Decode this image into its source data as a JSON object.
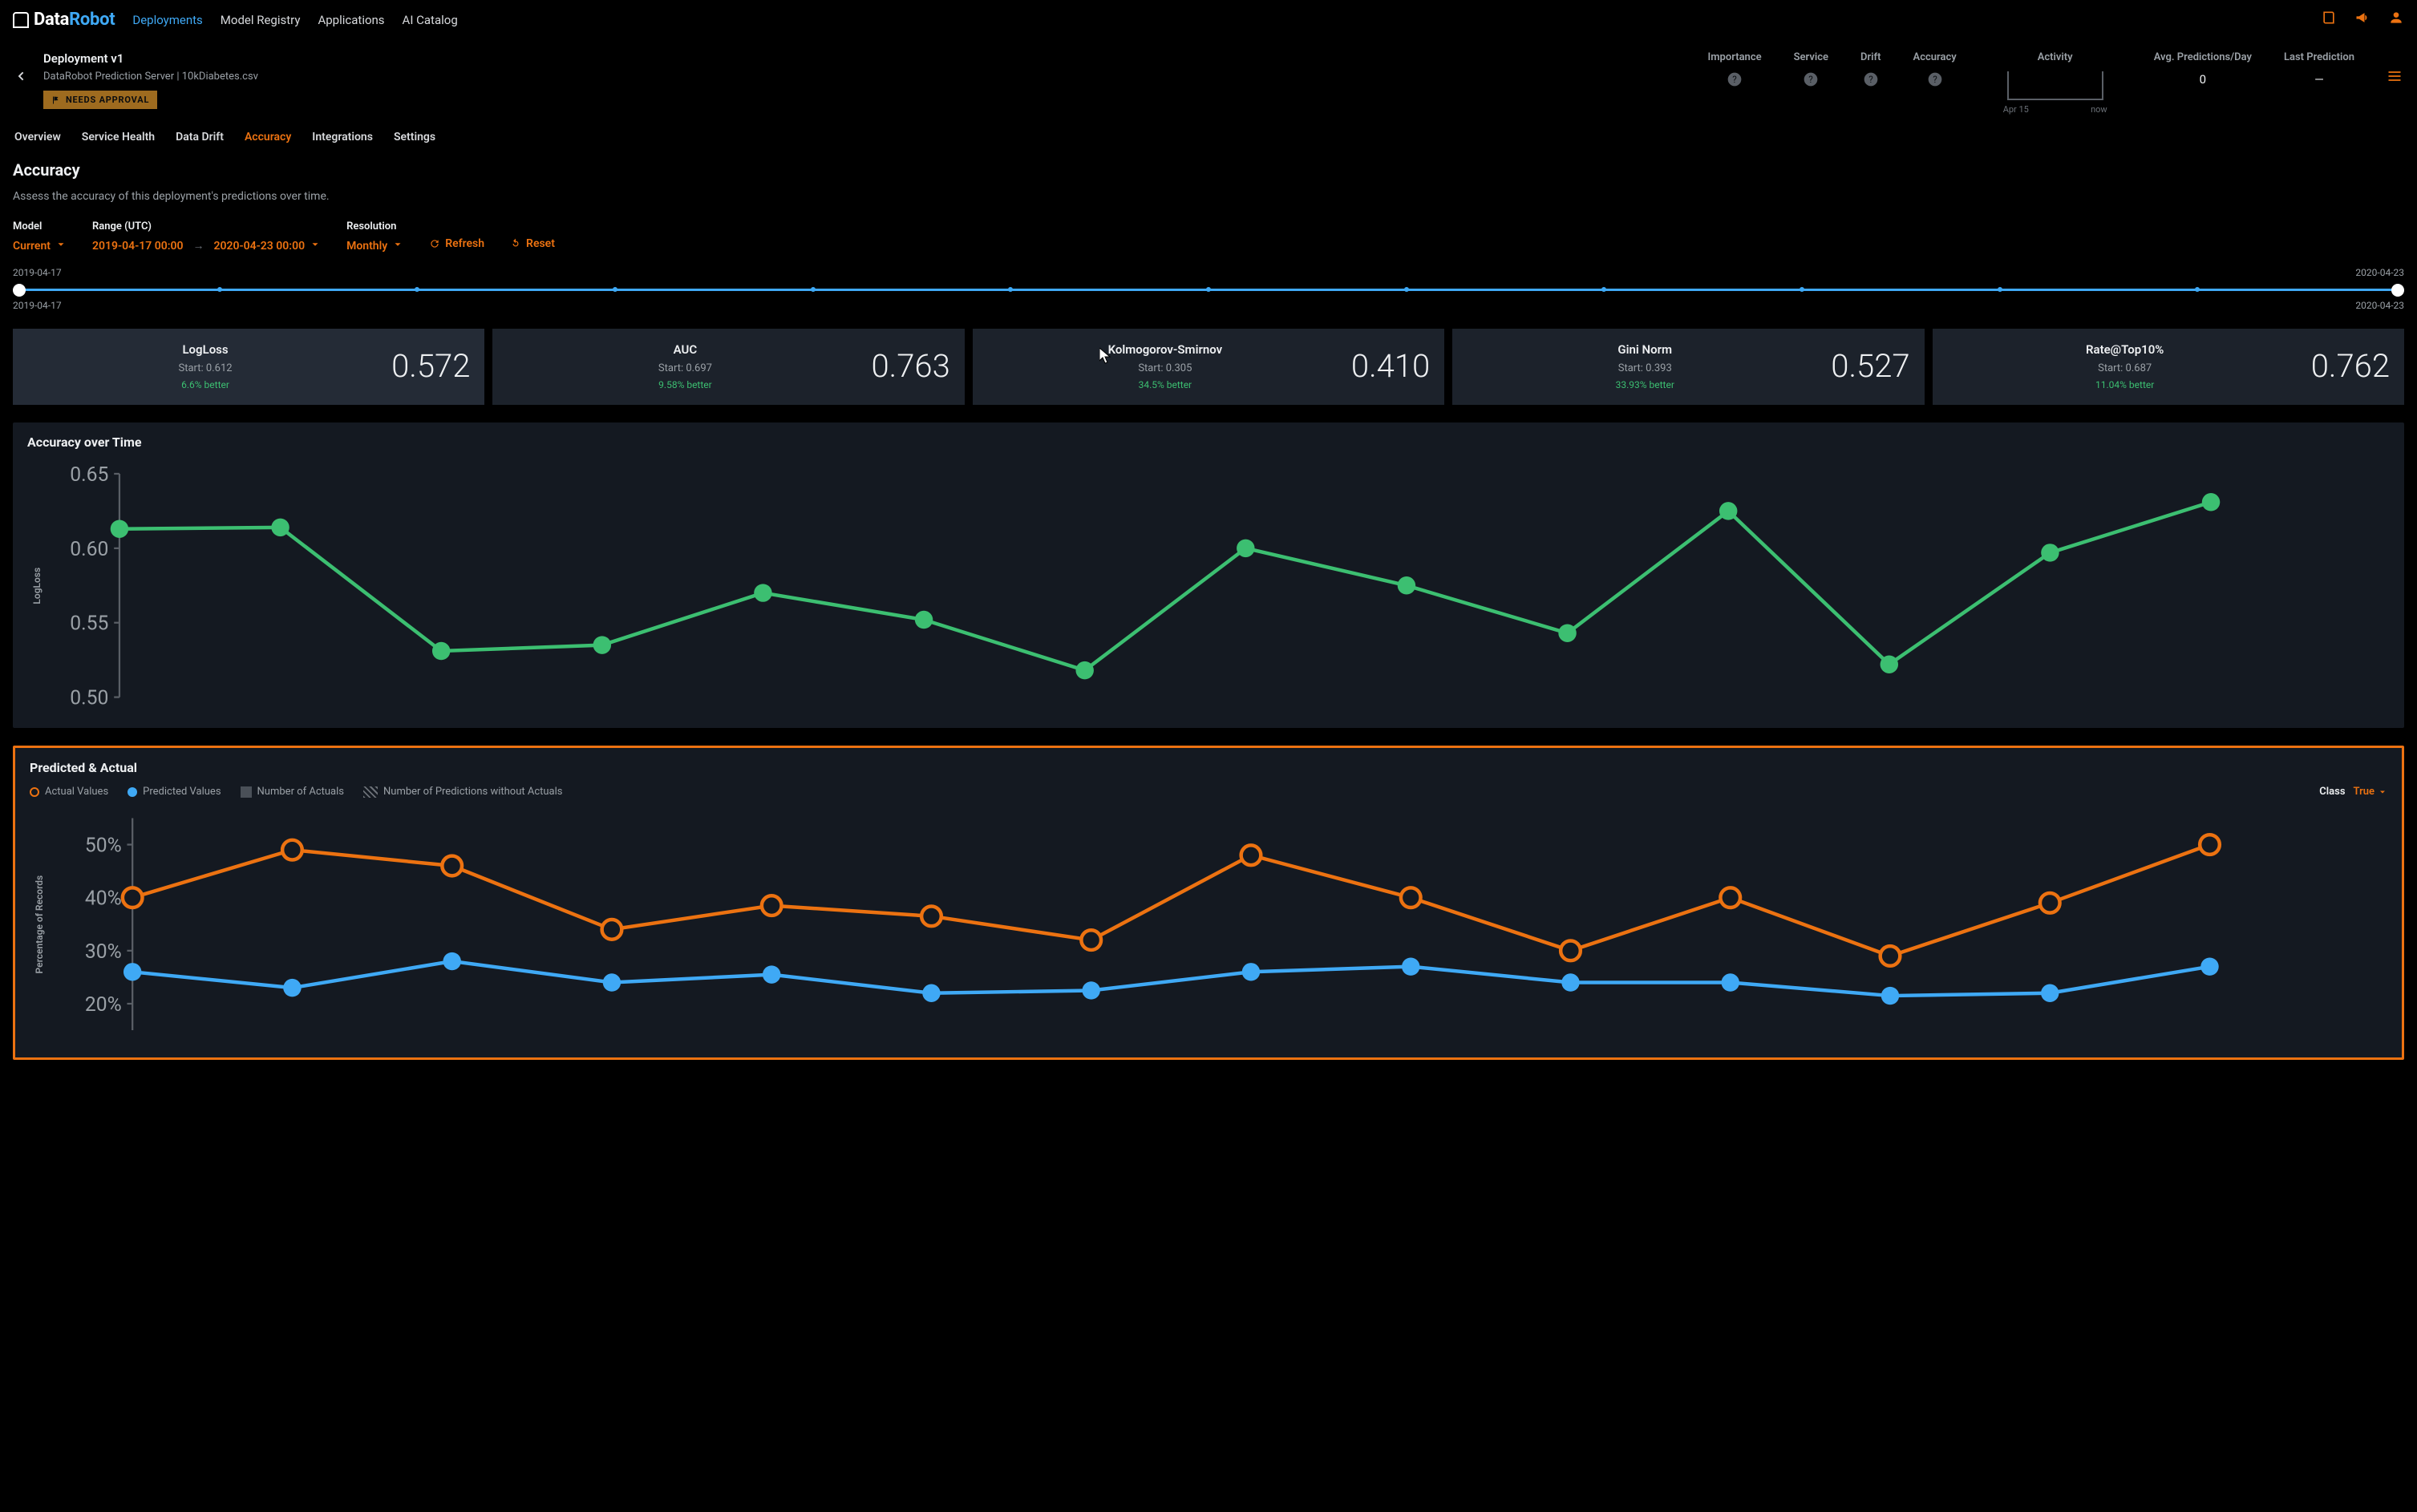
{
  "brand": {
    "part1": "Data",
    "part2": "Robot"
  },
  "top_nav": {
    "items": [
      {
        "label": "Deployments",
        "active": true
      },
      {
        "label": "Model Registry",
        "active": false
      },
      {
        "label": "Applications",
        "active": false
      },
      {
        "label": "AI Catalog",
        "active": false
      }
    ]
  },
  "deployment": {
    "title": "Deployment v1",
    "subtitle": "DataRobot Prediction Server | 10kDiabetes.csv",
    "tag": "NEEDS APPROVAL"
  },
  "header_stats": {
    "importance": "Importance",
    "service": "Service",
    "drift": "Drift",
    "accuracy": "Accuracy",
    "activity": "Activity",
    "activity_start": "Apr 15",
    "activity_end": "now",
    "avg_pred_label": "Avg. Predictions/Day",
    "avg_pred_value": "0",
    "last_pred_label": "Last Prediction",
    "last_pred_value": "—"
  },
  "tabs": [
    {
      "label": "Overview"
    },
    {
      "label": "Service Health"
    },
    {
      "label": "Data Drift"
    },
    {
      "label": "Accuracy",
      "active": true
    },
    {
      "label": "Integrations"
    },
    {
      "label": "Settings"
    }
  ],
  "page": {
    "title": "Accuracy",
    "subtitle": "Assess the accuracy of this deployment's predictions over time."
  },
  "filters": {
    "model_label": "Model",
    "model_value": "Current",
    "range_label": "Range (UTC)",
    "range_start": "2019-04-17  00:00",
    "range_end": "2020-04-23  00:00",
    "resolution_label": "Resolution",
    "resolution_value": "Monthly",
    "refresh": "Refresh",
    "reset": "Reset"
  },
  "slider": {
    "top_left": "2019-04-17",
    "top_right": "2020-04-23",
    "bottom_left": "2019-04-17",
    "bottom_right": "2020-04-23"
  },
  "metric_cards": [
    {
      "name": "LogLoss",
      "start": "Start: 0.612",
      "better": "6.6% better",
      "value": "0.572",
      "selected": true
    },
    {
      "name": "AUC",
      "start": "Start: 0.697",
      "better": "9.58% better",
      "value": "0.763"
    },
    {
      "name": "Kolmogorov-Smirnov",
      "start": "Start: 0.305",
      "better": "34.5% better",
      "value": "0.410"
    },
    {
      "name": "Gini Norm",
      "start": "Start: 0.393",
      "better": "33.93% better",
      "value": "0.527"
    },
    {
      "name": "Rate@Top10%",
      "start": "Start: 0.687",
      "better": "11.04% better",
      "value": "0.762"
    }
  ],
  "chart1": {
    "title": "Accuracy over Time",
    "ylabel": "LogLoss"
  },
  "chart2": {
    "title": "Predicted & Actual",
    "ylabel": "Percentage of Records",
    "legend": {
      "actual": "Actual Values",
      "predicted": "Predicted Values",
      "num_actuals": "Number of Actuals",
      "num_pred_wo_actuals": "Number of Predictions without Actuals"
    },
    "class_label": "Class",
    "class_value": "True"
  },
  "chart_data": [
    {
      "type": "line",
      "title": "Accuracy over Time",
      "ylabel": "LogLoss",
      "ylim": [
        0.5,
        0.65
      ],
      "yticks": [
        0.5,
        0.55,
        0.6,
        0.65
      ],
      "x_index": [
        0,
        1,
        2,
        3,
        4,
        5,
        6,
        7,
        8,
        9,
        10,
        11,
        12,
        13,
        14
      ],
      "series": [
        {
          "name": "LogLoss",
          "color": "#3cbf71",
          "values": [
            0.613,
            0.614,
            0.531,
            0.535,
            0.57,
            0.552,
            0.518,
            0.6,
            0.575,
            0.543,
            0.625,
            0.522,
            0.597,
            0.631,
            null
          ]
        }
      ]
    },
    {
      "type": "line",
      "title": "Predicted & Actual",
      "ylabel": "Percentage of Records",
      "ylim": [
        15,
        55
      ],
      "yticks": [
        20,
        30,
        40,
        50
      ],
      "x_index": [
        0,
        1,
        2,
        3,
        4,
        5,
        6,
        7,
        8,
        9,
        10,
        11,
        12,
        13,
        14
      ],
      "series": [
        {
          "name": "Actual Values",
          "color": "#ec7211",
          "values": [
            40,
            49,
            46,
            34,
            38.5,
            36.5,
            32,
            48,
            40,
            30,
            40,
            29,
            39,
            50,
            null
          ]
        },
        {
          "name": "Predicted Values",
          "color": "#3fa9f5",
          "values": [
            26,
            23,
            28,
            24,
            25.5,
            22,
            22.5,
            26,
            27,
            24,
            24,
            21.5,
            22,
            27,
            null
          ]
        }
      ]
    }
  ]
}
